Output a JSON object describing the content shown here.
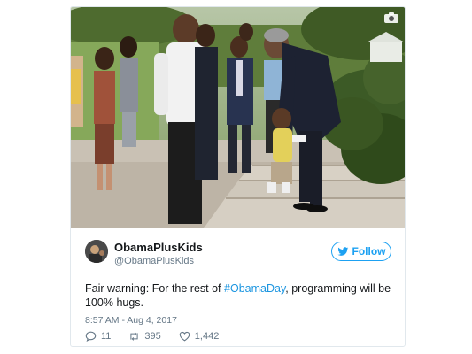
{
  "tweet": {
    "display_name": "ObamaPlusKids",
    "handle": "@ObamaPlusKids",
    "follow_label": "Follow",
    "text_before": "Fair warning: For the rest of ",
    "hashtag": "#ObamaDay",
    "text_after": ", programming will be 100% hugs.",
    "timestamp": "8:57 AM - Aug 4, 2017",
    "replies": "11",
    "retweets": "395",
    "likes": "1,442"
  },
  "icons": {
    "camera": "camera-icon",
    "bird": "twitter-bird-icon",
    "reply": "reply-icon",
    "retweet": "retweet-icon",
    "like": "heart-icon"
  },
  "colors": {
    "accent": "#1da1f2",
    "hashtag": "#1b95e0",
    "secondary_text": "#657786",
    "primary_text": "#14171a"
  }
}
